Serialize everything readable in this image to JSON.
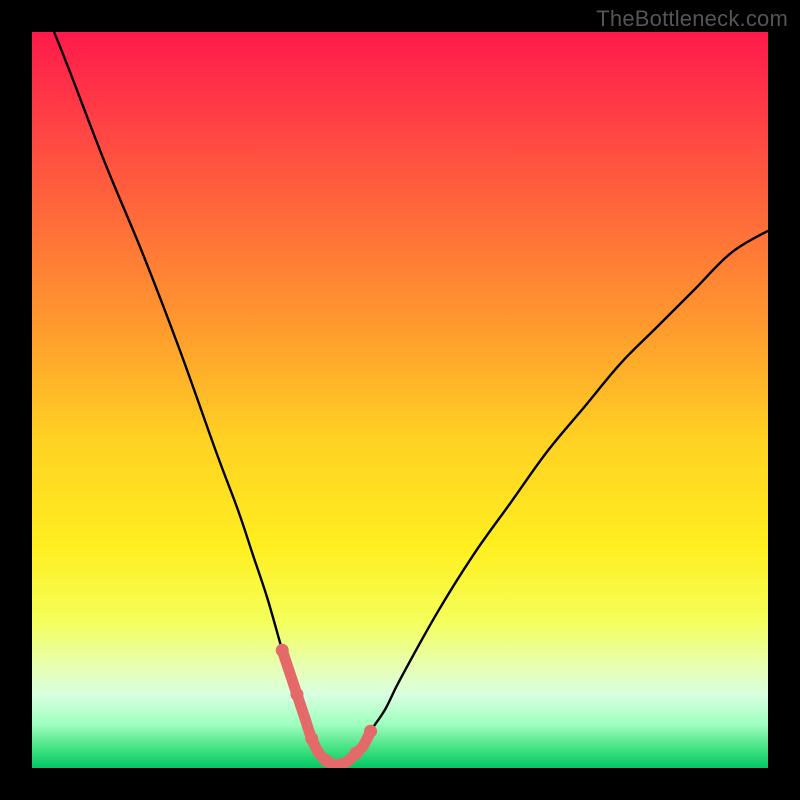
{
  "watermark": "TheBottleneck.com",
  "gradient_stops": [
    {
      "offset": 0.0,
      "color": "#ff1a4b"
    },
    {
      "offset": 0.1,
      "color": "#ff3a46"
    },
    {
      "offset": 0.25,
      "color": "#ff6a3a"
    },
    {
      "offset": 0.4,
      "color": "#ff9a2e"
    },
    {
      "offset": 0.55,
      "color": "#ffd023"
    },
    {
      "offset": 0.7,
      "color": "#ffef20"
    },
    {
      "offset": 0.8,
      "color": "#f4ff5a"
    },
    {
      "offset": 0.86,
      "color": "#e8ffb0"
    },
    {
      "offset": 0.9,
      "color": "#d9ffe0"
    },
    {
      "offset": 0.94,
      "color": "#a0ffc0"
    },
    {
      "offset": 0.975,
      "color": "#40e080"
    },
    {
      "offset": 1.0,
      "color": "#00c864"
    }
  ],
  "highlight_color": "#e46a6a",
  "curve_color": "#000000",
  "chart_data": {
    "type": "line",
    "title": "",
    "xlabel": "",
    "ylabel": "",
    "xlim": [
      0,
      100
    ],
    "ylim": [
      0,
      100
    ],
    "series": [
      {
        "name": "bottleneck-curve",
        "x": [
          3,
          5,
          10,
          15,
          20,
          25,
          28,
          30,
          32,
          34,
          35,
          36,
          37,
          38,
          39,
          40,
          41,
          42,
          43,
          44,
          45,
          46,
          48,
          50,
          55,
          60,
          65,
          70,
          75,
          80,
          85,
          90,
          95,
          100
        ],
        "y": [
          100,
          95,
          82,
          70,
          57,
          43,
          35,
          29,
          23,
          16,
          13,
          10,
          7,
          4,
          2,
          1,
          0.5,
          0.5,
          1,
          2,
          3,
          5,
          8,
          12,
          21,
          29,
          36,
          43,
          49,
          55,
          60,
          65,
          70,
          73
        ]
      },
      {
        "name": "highlight-band",
        "x": [
          34,
          35,
          36,
          37,
          38,
          39,
          40,
          41,
          42,
          43,
          44,
          45,
          46
        ],
        "y": [
          16,
          13,
          10,
          7,
          4,
          2,
          1,
          0.5,
          0.5,
          1,
          2,
          3,
          5
        ]
      }
    ]
  }
}
